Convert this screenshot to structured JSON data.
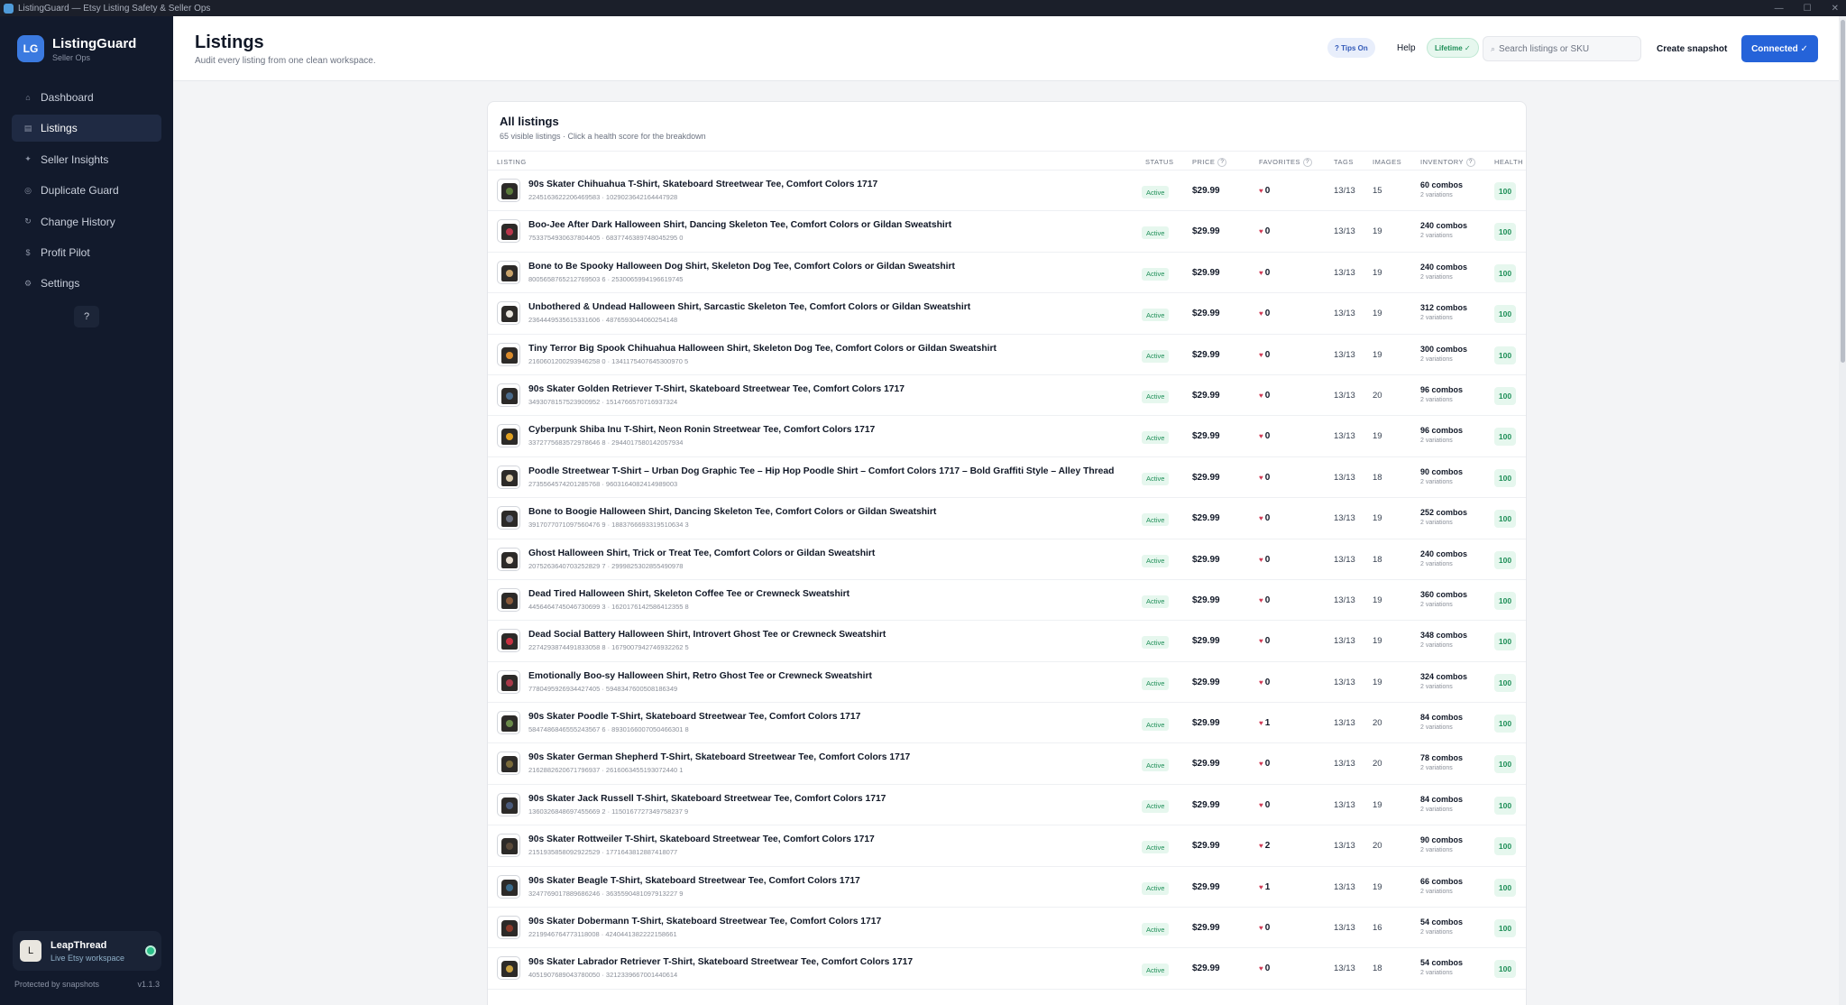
{
  "window": {
    "title": "ListingGuard — Etsy Listing Safety & Seller Ops",
    "controls": [
      "—",
      "☐",
      "✕"
    ]
  },
  "brand": {
    "logo": "LG",
    "name": "ListingGuard",
    "sub": "Seller Ops"
  },
  "sidebar": {
    "items": [
      {
        "label": "Dashboard",
        "icon": "home-icon",
        "glyph": "⌂"
      },
      {
        "label": "Listings",
        "icon": "list-icon",
        "glyph": "▤"
      },
      {
        "label": "Seller Insights",
        "icon": "sparkle-icon",
        "glyph": "✦"
      },
      {
        "label": "Duplicate Guard",
        "icon": "target-icon",
        "glyph": "◎"
      },
      {
        "label": "Change History",
        "icon": "history-icon",
        "glyph": "↻"
      },
      {
        "label": "Profit Pilot",
        "icon": "dollar-icon",
        "glyph": "$"
      },
      {
        "label": "Settings",
        "icon": "gear-icon",
        "glyph": "⚙"
      }
    ],
    "help_label": "?",
    "account": {
      "avatar": "L",
      "name": "LeapThread",
      "sub": "Live Etsy workspace"
    },
    "footer_left": "Protected by snapshots",
    "footer_right": "v1.1.3"
  },
  "header": {
    "title": "Listings",
    "subtitle": "Audit every listing from one clean workspace.",
    "tips_label": "? Tips On",
    "help_label": "Help",
    "lifetime_label": "Lifetime ✓",
    "search_placeholder": "Search listings or SKU",
    "create_label": "Create snapshot",
    "connected_label": "Connected ✓"
  },
  "card": {
    "title": "All listings",
    "subtitle": "65 visible listings · Click a health score for the breakdown",
    "columns": {
      "listing": "LISTING",
      "status": "STATUS",
      "price": "PRICE",
      "favorites": "FAVORITES",
      "tags": "TAGS",
      "images": "IMAGES",
      "inventory": "INVENTORY",
      "health": "HEALTH"
    }
  },
  "listings": [
    {
      "title": "90s Skater Chihuahua T-Shirt, Skateboard Streetwear Tee, Comfort Colors 1717",
      "ids": "2245163622206469583 · 1029023642164447928",
      "status": "Active",
      "price": "$29.99",
      "favorites": "0",
      "tags": "13/13",
      "images": "15",
      "inventory": "60 combos",
      "variations": "2 variations",
      "health": "100",
      "accent": "#5a7a3a"
    },
    {
      "title": "Boo-Jee After Dark Halloween Shirt, Dancing Skeleton Tee, Comfort Colors or Gildan Sweatshirt",
      "ids": "7533754930637804405 · 6837746389748045295 0",
      "status": "Active",
      "price": "$29.99",
      "favorites": "0",
      "tags": "13/13",
      "images": "19",
      "inventory": "240 combos",
      "variations": "2 variations",
      "health": "100",
      "accent": "#b8354a"
    },
    {
      "title": "Bone to Be Spooky Halloween Dog Shirt, Skeleton Dog Tee, Comfort Colors or Gildan Sweatshirt",
      "ids": "8005658765212769503 6 · 2530065994196619745",
      "status": "Active",
      "price": "$29.99",
      "favorites": "0",
      "tags": "13/13",
      "images": "19",
      "inventory": "240 combos",
      "variations": "2 variations",
      "health": "100",
      "accent": "#c9a36a"
    },
    {
      "title": "Unbothered & Undead Halloween Shirt, Sarcastic Skeleton Tee, Comfort Colors or Gildan Sweatshirt",
      "ids": "2364449535615331606 · 4876593044060254148",
      "status": "Active",
      "price": "$29.99",
      "favorites": "0",
      "tags": "13/13",
      "images": "19",
      "inventory": "312 combos",
      "variations": "2 variations",
      "health": "100",
      "accent": "#e8e4dc"
    },
    {
      "title": "Tiny Terror Big Spook Chihuahua Halloween Shirt, Skeleton Dog Tee, Comfort Colors or Gildan Sweatshirt",
      "ids": "2160601200293946258 0 · 1341175407645300970 5",
      "status": "Active",
      "price": "$29.99",
      "favorites": "0",
      "tags": "13/13",
      "images": "19",
      "inventory": "300 combos",
      "variations": "2 variations",
      "health": "100",
      "accent": "#d98a2b"
    },
    {
      "title": "90s Skater Golden Retriever T-Shirt, Skateboard Streetwear Tee, Comfort Colors 1717",
      "ids": "3493078157523900952 · 1514766570716937324",
      "status": "Active",
      "price": "$29.99",
      "favorites": "0",
      "tags": "13/13",
      "images": "20",
      "inventory": "96 combos",
      "variations": "2 variations",
      "health": "100",
      "accent": "#4a6a8a"
    },
    {
      "title": "Cyberpunk Shiba Inu T-Shirt, Neon Ronin Streetwear Tee, Comfort Colors 1717",
      "ids": "3372775683572978646 8 · 2944017580142057934",
      "status": "Active",
      "price": "$29.99",
      "favorites": "0",
      "tags": "13/13",
      "images": "19",
      "inventory": "96 combos",
      "variations": "2 variations",
      "health": "100",
      "accent": "#e0a020"
    },
    {
      "title": "Poodle Streetwear T-Shirt – Urban Dog Graphic Tee – Hip Hop Poodle Shirt – Comfort Colors 1717 – Bold Graffiti Style – Alley Thread",
      "ids": "2735564574201285768 · 9603164082414989003",
      "status": "Active",
      "price": "$29.99",
      "favorites": "0",
      "tags": "13/13",
      "images": "18",
      "inventory": "90 combos",
      "variations": "2 variations",
      "health": "100",
      "accent": "#d8c8a8"
    },
    {
      "title": "Bone to Boogie Halloween Shirt, Dancing Skeleton Tee, Comfort Colors or Gildan Sweatshirt",
      "ids": "3917077071097560476 9 · 1883766693319510634 3",
      "status": "Active",
      "price": "$29.99",
      "favorites": "0",
      "tags": "13/13",
      "images": "19",
      "inventory": "252 combos",
      "variations": "2 variations",
      "health": "100",
      "accent": "#6a7080"
    },
    {
      "title": "Ghost Halloween Shirt, Trick or Treat Tee, Comfort Colors or Gildan Sweatshirt",
      "ids": "2075263640703252829 7 · 2999825302855490978",
      "status": "Active",
      "price": "$29.99",
      "favorites": "0",
      "tags": "13/13",
      "images": "18",
      "inventory": "240 combos",
      "variations": "2 variations",
      "health": "100",
      "accent": "#e8ddd0"
    },
    {
      "title": "Dead Tired Halloween Shirt, Skeleton Coffee Tee or Crewneck Sweatshirt",
      "ids": "4456464745046730699 3 · 1620176142586412355 8",
      "status": "Active",
      "price": "$29.99",
      "favorites": "0",
      "tags": "13/13",
      "images": "19",
      "inventory": "360 combos",
      "variations": "2 variations",
      "health": "100",
      "accent": "#8a5a3a"
    },
    {
      "title": "Dead Social Battery Halloween Shirt, Introvert Ghost Tee or Crewneck Sweatshirt",
      "ids": "2274293874491833058 8 · 1679007942746932262 5",
      "status": "Active",
      "price": "$29.99",
      "favorites": "0",
      "tags": "13/13",
      "images": "19",
      "inventory": "348 combos",
      "variations": "2 variations",
      "health": "100",
      "accent": "#c83040"
    },
    {
      "title": "Emotionally Boo-sy Halloween Shirt, Retro Ghost Tee or Crewneck Sweatshirt",
      "ids": "7780495926934427405 · 5948347600508186349",
      "status": "Active",
      "price": "$29.99",
      "favorites": "0",
      "tags": "13/13",
      "images": "19",
      "inventory": "324 combos",
      "variations": "2 variations",
      "health": "100",
      "accent": "#a83848"
    },
    {
      "title": "90s Skater Poodle T-Shirt, Skateboard Streetwear Tee, Comfort Colors 1717",
      "ids": "5847486846555243567 6 · 8930166007050466301 8",
      "status": "Active",
      "price": "$29.99",
      "favorites": "1",
      "tags": "13/13",
      "images": "20",
      "inventory": "84 combos",
      "variations": "2 variations",
      "health": "100",
      "accent": "#6a8a4a"
    },
    {
      "title": "90s Skater German Shepherd T-Shirt, Skateboard Streetwear Tee, Comfort Colors 1717",
      "ids": "2162882620671796937 · 2616063455193072440 1",
      "status": "Active",
      "price": "$29.99",
      "favorites": "0",
      "tags": "13/13",
      "images": "20",
      "inventory": "78 combos",
      "variations": "2 variations",
      "health": "100",
      "accent": "#7a6a3a"
    },
    {
      "title": "90s Skater Jack Russell T-Shirt, Skateboard Streetwear Tee, Comfort Colors 1717",
      "ids": "1360326848697455669 2 · 1150167727349758237 9",
      "status": "Active",
      "price": "$29.99",
      "favorites": "0",
      "tags": "13/13",
      "images": "19",
      "inventory": "84 combos",
      "variations": "2 variations",
      "health": "100",
      "accent": "#4a5a7a"
    },
    {
      "title": "90s Skater Rottweiler T-Shirt, Skateboard Streetwear Tee, Comfort Colors 1717",
      "ids": "2151935858092922529 · 1771643812887418077",
      "status": "Active",
      "price": "$29.99",
      "favorites": "2",
      "tags": "13/13",
      "images": "20",
      "inventory": "90 combos",
      "variations": "2 variations",
      "health": "100",
      "accent": "#5a4a3a"
    },
    {
      "title": "90s Skater Beagle T-Shirt, Skateboard Streetwear Tee, Comfort Colors 1717",
      "ids": "3247769017889686246 · 3635590481097913227 9",
      "status": "Active",
      "price": "$29.99",
      "favorites": "1",
      "tags": "13/13",
      "images": "19",
      "inventory": "66 combos",
      "variations": "2 variations",
      "health": "100",
      "accent": "#3a6a8a"
    },
    {
      "title": "90s Skater Dobermann T-Shirt, Skateboard Streetwear Tee, Comfort Colors 1717",
      "ids": "2219946764773118008 · 4240441382222158661",
      "status": "Active",
      "price": "$29.99",
      "favorites": "0",
      "tags": "13/13",
      "images": "16",
      "inventory": "54 combos",
      "variations": "2 variations",
      "health": "100",
      "accent": "#8a3a2a"
    },
    {
      "title": "90s Skater Labrador Retriever T-Shirt, Skateboard Streetwear Tee, Comfort Colors 1717",
      "ids": "4051907689043780050 · 3212339667001440614",
      "status": "Active",
      "price": "$29.99",
      "favorites": "0",
      "tags": "13/13",
      "images": "18",
      "inventory": "54 combos",
      "variations": "2 variations",
      "health": "100",
      "accent": "#c8a040"
    }
  ]
}
